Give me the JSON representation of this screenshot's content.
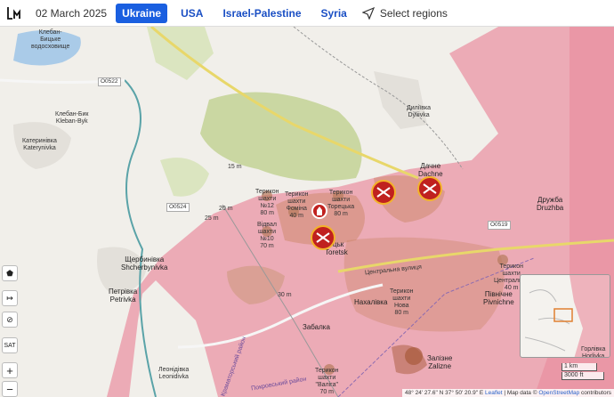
{
  "topbar": {
    "date": "02 March 2025",
    "tabs": [
      {
        "label": "Ukraine",
        "active": true
      },
      {
        "label": "USA",
        "active": false
      },
      {
        "label": "Israel-Palestine",
        "active": false
      },
      {
        "label": "Syria",
        "active": false
      }
    ],
    "select_regions": "Select regions"
  },
  "colors": {
    "occupied": "#e8738a",
    "contested": "#c9825f",
    "accent": "#1a5fe0",
    "marker": "#c0211f"
  },
  "places": {
    "klebanbyk": "Клебан-Бик\nKleban-Byk",
    "katerynivka": "Катеринівка\nKaterynivka",
    "klebanbyk_lake": "Клебан-\nБицьке\nводосховище",
    "shcherbynivka": "Щербинівка\nShcherbynivka",
    "petrivka": "Петрівка\nPetrivka",
    "leonidivka": "Леонідівка\nLeonidivka",
    "dyliivka": "Диліївка\nDyliivka",
    "dachne": "Дачне\nDachne",
    "druzhba": "Дружба\nDruzhba",
    "toretsk": "ецьк\nToretsk",
    "nakhalivka": "Нахалівка",
    "zabalka": "Забалка",
    "pivnichne": "Північне\nPivnichne",
    "zalizne": "Залізне\nZalizne",
    "horlivka": "Горлівка\nHorlivka",
    "terykon_12": "Терикон\nшахти\n№12\n80 m",
    "terykon_fomina": "Терикон\nшахти\nФоміна\n40 m",
    "terykon_toretska": "Терикон\nшахти\nТорецька\n80 m",
    "vidval_10": "Відвал\nшахти\n№10\n70 m",
    "terykon_tsentralna": "Терикон\nшахти\nЦентральна\n40 m",
    "terykon_nova": "Терикон\nшахти\nНова\n80 m",
    "terykon_valiha": "Терикон\nшахти\n\"Валіга\"\n70 m",
    "elev_15": "15 m",
    "elev_20": "20 m",
    "elev_25": "25 m",
    "elev_30": "30 m",
    "road_o0522": "O0522",
    "road_o0524": "O0524",
    "road_o0519": "O0519",
    "street_tsentralna": "Центральна вулиця",
    "district": "Покровський район",
    "kramatorsk_district": "Краматорський район"
  },
  "controls": [
    {
      "name": "layer-button",
      "icon": "pentagon-icon",
      "label": "⬟"
    },
    {
      "name": "measure-button",
      "icon": "ruler-icon",
      "label": "↦"
    },
    {
      "name": "hide-button",
      "icon": "eye-slash-icon",
      "label": "⊘"
    },
    {
      "name": "satellite-button",
      "icon": "satellite-icon",
      "label": "SAT"
    },
    {
      "name": "zoom-in-button",
      "icon": "plus-icon",
      "label": "+"
    },
    {
      "name": "zoom-out-button",
      "icon": "minus-icon",
      "label": "−"
    }
  ],
  "scale": {
    "km": "1 km",
    "ft": "3000 ft"
  },
  "attribution": {
    "coords": "48° 24' 27.6\" N 37° 50' 20.9\" E",
    "leaflet": "Leaflet",
    "text": " | Map data © ",
    "osm": "OpenStreetMap",
    "contributors": " contributors"
  }
}
